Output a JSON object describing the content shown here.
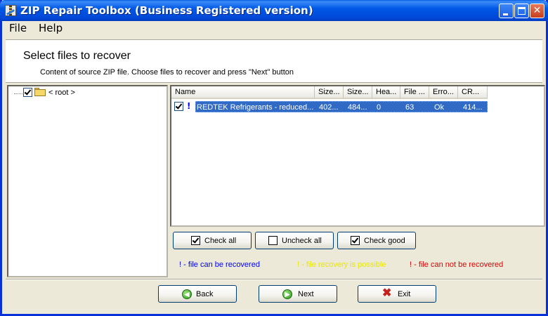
{
  "window": {
    "title": "ZIP Repair Toolbox (Business Registered version)"
  },
  "menu": {
    "file": "File",
    "help": "Help"
  },
  "header": {
    "title": "Select files to recover",
    "subtitle": "Content of source ZIP file. Choose files to recover and press \"Next\" button"
  },
  "tree": {
    "root_label": "< root >",
    "root_checked": true
  },
  "list": {
    "columns": [
      "Name",
      "Size...",
      "Size...",
      "Hea...",
      "File ...",
      "Erro...",
      "CR..."
    ],
    "rows": [
      {
        "checked": true,
        "status": "!",
        "name": "REDTEK Refrigerants - reduced....",
        "size1": "402...",
        "size2": "484...",
        "header": "0",
        "file": "63",
        "error": "Ok",
        "crc": "414..."
      }
    ]
  },
  "buttons": {
    "check_all": "Check all",
    "uncheck_all": "Uncheck all",
    "check_good": "Check good",
    "back": "Back",
    "next": "Next",
    "exit": "Exit"
  },
  "legend": {
    "recoverable": "! - file can be recovered",
    "possible": "! - file recovery is possible",
    "not_recoverable": "! - file can not be recovered"
  },
  "colors": {
    "recoverable": "#0000EE",
    "possible": "#E8E800",
    "not_recoverable": "#E00000",
    "selection": "#316AC5"
  }
}
